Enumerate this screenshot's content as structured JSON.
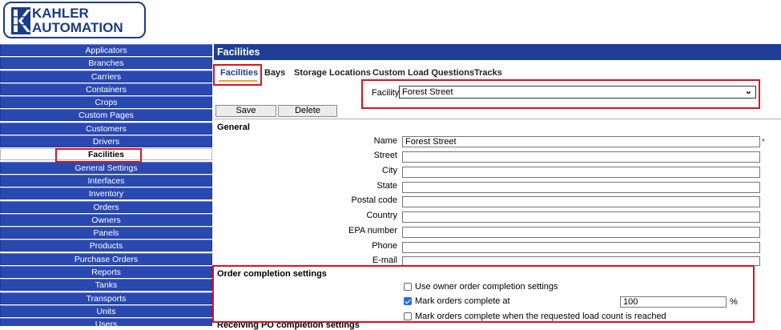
{
  "logo": {
    "line1": "KAHLER",
    "line2": "AUTOMATION"
  },
  "sidebar": {
    "items": [
      {
        "label": "Applicators",
        "active": false
      },
      {
        "label": "Branches",
        "active": false
      },
      {
        "label": "Carriers",
        "active": false
      },
      {
        "label": "Containers",
        "active": false
      },
      {
        "label": "Crops",
        "active": false
      },
      {
        "label": "Custom Pages",
        "active": false
      },
      {
        "label": "Customers",
        "active": false
      },
      {
        "label": "Drivers",
        "active": false
      },
      {
        "label": "Facilities",
        "active": true
      },
      {
        "label": "General Settings",
        "active": false
      },
      {
        "label": "Interfaces",
        "active": false
      },
      {
        "label": "Inventory",
        "active": false
      },
      {
        "label": "Orders",
        "active": false
      },
      {
        "label": "Owners",
        "active": false
      },
      {
        "label": "Panels",
        "active": false
      },
      {
        "label": "Products",
        "active": false
      },
      {
        "label": "Purchase Orders",
        "active": false
      },
      {
        "label": "Reports",
        "active": false
      },
      {
        "label": "Tanks",
        "active": false
      },
      {
        "label": "Transports",
        "active": false
      },
      {
        "label": "Units",
        "active": false
      },
      {
        "label": "Users",
        "active": false
      }
    ]
  },
  "header": {
    "title": "Facilities"
  },
  "tabs": [
    "Facilities",
    "Bays",
    "Storage Locations",
    "Custom Load Questions",
    "Tracks"
  ],
  "facility": {
    "label": "Facility",
    "selected": "Forest Street"
  },
  "toolbar": {
    "save": "Save",
    "delete": "Delete"
  },
  "general": {
    "title": "General",
    "fields": [
      {
        "label": "Name",
        "value": "Forest Street"
      },
      {
        "label": "Street",
        "value": ""
      },
      {
        "label": "City",
        "value": ""
      },
      {
        "label": "State",
        "value": ""
      },
      {
        "label": "Postal code",
        "value": ""
      },
      {
        "label": "Country",
        "value": ""
      },
      {
        "label": "EPA number",
        "value": ""
      },
      {
        "label": "Phone",
        "value": ""
      },
      {
        "label": "E-mail",
        "value": ""
      }
    ],
    "required_mark": "*"
  },
  "order_completion": {
    "title": "Order completion settings",
    "use_owner": {
      "label": "Use owner order completion settings",
      "checked": false
    },
    "mark_complete_at": {
      "label": "Mark orders complete at",
      "checked": true,
      "value": "100",
      "unit": "%"
    },
    "mark_complete_load_count": {
      "label": "Mark orders complete when the requested load count is reached",
      "checked": false
    }
  },
  "receiving_po": {
    "title": "Receiving PO completion settings"
  },
  "colors": {
    "nav_blue": "#2a49b0",
    "header_blue": "#1f3f96",
    "highlight_red": "#e01020",
    "tab_underline": "#f0a030"
  }
}
